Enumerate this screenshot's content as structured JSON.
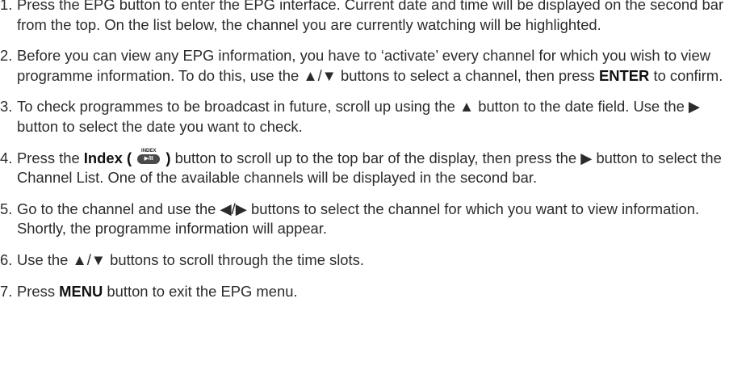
{
  "steps": [
    {
      "number": "1.",
      "text": "Press the EPG button to enter the EPG interface. Current date and time will be displayed on the second bar from the top. On the list below, the channel you are currently watching will be highlighted."
    },
    {
      "number": "2.",
      "text_before": "Before you can view any EPG information, you have to ‘activate’ every channel for which you wish to view programme information. To do this, use the ▲/▼ buttons to select a channel, then press ",
      "bold": "ENTER",
      "text_after": " to confirm."
    },
    {
      "number": "3.",
      "text": "To check programmes to be broadcast in future, scroll up using the ▲ button to the date field. Use the ▶ button to select the date you want to check."
    },
    {
      "number": "4.",
      "text_before": "Press the ",
      "bold_open": "Index (",
      "icon_caption": "INDEX",
      "icon_glyph": "▶/II",
      "icon_name": "index-button-icon",
      "bold_close": ")",
      "text_after": " button to scroll up to the top bar of the display, then press the ▶ button to select the Channel List. One of the available channels will be displayed in the second bar."
    },
    {
      "number": "5.",
      "text": "Go to the channel and use the ◀/▶ buttons to select the channel for which you want to view information. Shortly, the programme information will appear."
    },
    {
      "number": "6.",
      "text": "Use the ▲/▼ buttons to scroll through the time slots."
    },
    {
      "number": "7.",
      "text_before": "Press ",
      "bold": "MENU",
      "text_after": " button to exit the EPG menu."
    }
  ],
  "colors": {
    "text": "#2b2b2b",
    "bold_text": "#111111",
    "icon_fill": "#4a4a4a"
  }
}
